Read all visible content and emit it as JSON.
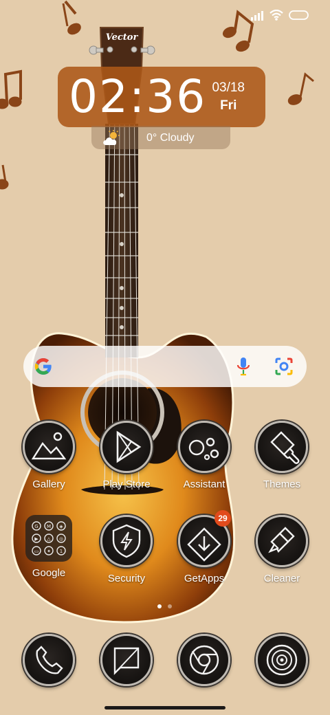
{
  "clock": {
    "time": "02:36",
    "date": "03/18",
    "day": "Fri"
  },
  "weather": {
    "text": "0° Cloudy",
    "icon": "partly-cloudy-icon"
  },
  "guitar_brand": "Vector",
  "search": {
    "google_icon": "google-g-icon",
    "mic_icon": "microphone-icon",
    "lens_icon": "google-lens-icon"
  },
  "apps": [
    {
      "label": "Gallery",
      "icon": "mountain-icon"
    },
    {
      "label": "Play Store",
      "icon": "play-icon"
    },
    {
      "label": "Assistant",
      "icon": "assistant-icon"
    },
    {
      "label": "Themes",
      "icon": "brush-icon"
    },
    {
      "label": "Google",
      "icon": "folder-icon"
    },
    {
      "label": "Security",
      "icon": "shield-bolt-icon"
    },
    {
      "label": "GetApps",
      "icon": "getapps-icon",
      "badge": "29"
    },
    {
      "label": "Cleaner",
      "icon": "cleaner-brush-icon"
    }
  ],
  "dock": [
    {
      "icon": "phone-icon"
    },
    {
      "icon": "messages-icon"
    },
    {
      "icon": "chrome-icon"
    },
    {
      "icon": "camera-icon"
    }
  ],
  "pager": {
    "pages": 2,
    "current": 1
  },
  "colors": {
    "wallpaper": "#e4ccab",
    "clock_bg": "#ac5818",
    "notes": "#8a4518",
    "badge": "#e24b1c"
  }
}
